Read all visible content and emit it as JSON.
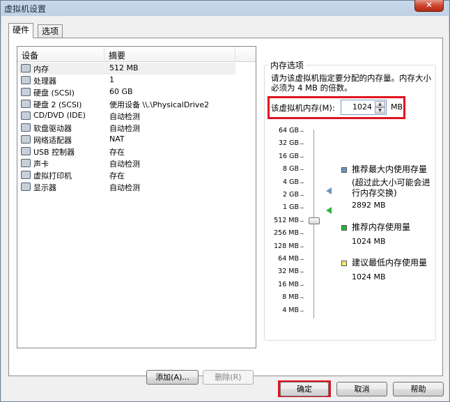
{
  "window": {
    "title": "虚拟机设置",
    "close_glyph": "✕"
  },
  "tabs": [
    {
      "label": "硬件",
      "active": true
    },
    {
      "label": "选项",
      "active": false
    }
  ],
  "device_list": {
    "columns": [
      "设备",
      "摘要"
    ],
    "rows": [
      {
        "name": "内存",
        "summary": "512 MB",
        "icon": "memory-icon",
        "selected": true
      },
      {
        "name": "处理器",
        "summary": "1",
        "icon": "processor-icon"
      },
      {
        "name": "硬盘 (SCSI)",
        "summary": "60 GB",
        "icon": "hard-disk-icon"
      },
      {
        "name": "硬盘 2 (SCSI)",
        "summary": "使用设备 \\\\.\\PhysicalDrive2",
        "icon": "hard-disk-icon"
      },
      {
        "name": "CD/DVD (IDE)",
        "summary": "自动检测",
        "icon": "cd-dvd-icon"
      },
      {
        "name": "软盘驱动器",
        "summary": "自动检测",
        "icon": "floppy-icon"
      },
      {
        "name": "网络适配器",
        "summary": "NAT",
        "icon": "network-adapter-icon"
      },
      {
        "name": "USB 控制器",
        "summary": "存在",
        "icon": "usb-icon"
      },
      {
        "name": "声卡",
        "summary": "自动检测",
        "icon": "sound-card-icon"
      },
      {
        "name": "虚拟打印机",
        "summary": "存在",
        "icon": "printer-icon"
      },
      {
        "name": "显示器",
        "summary": "自动检测",
        "icon": "display-icon"
      }
    ]
  },
  "list_buttons": {
    "add": "添加(A)...",
    "remove": "删除(R)"
  },
  "memory": {
    "group_title": "内存选项",
    "description": "请为该虚拟机指定要分配的内存量。内存大小必须为 4 MB 的倍数。",
    "field_label": "该虚拟机内存(M):",
    "value": "1024",
    "unit": "MB",
    "scale_labels": [
      "64 GB",
      "32 GB",
      "16 GB",
      "8 GB",
      "4 GB",
      "2 GB",
      "1 GB",
      "512 MB",
      "256 MB",
      "128 MB",
      "64 MB",
      "32 MB",
      "16 MB",
      "8 MB",
      "4 MB"
    ],
    "slider_level_label": "512 MB",
    "legend": [
      {
        "label": "推荐最大内使用存量",
        "note": "(超过此大小可能会进行内存交换)",
        "value": "2892 MB",
        "color": "#6f94c0"
      },
      {
        "label": "推荐内存使用量",
        "value": "1024 MB",
        "color": "#2bb33a"
      },
      {
        "label": "建议最低内存使用量",
        "value": "1024 MB",
        "color": "#f4e96a"
      }
    ]
  },
  "dialog_buttons": {
    "ok": "确定",
    "cancel": "取消",
    "help": "帮助"
  },
  "highlight_color": "#e0141e"
}
